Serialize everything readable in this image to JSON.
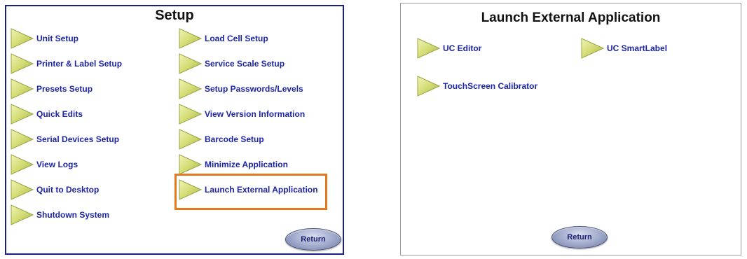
{
  "setup_screen": {
    "title": "Setup",
    "left_items": [
      {
        "label": "Unit Setup"
      },
      {
        "label": "Printer & Label Setup"
      },
      {
        "label": "Presets Setup"
      },
      {
        "label": "Quick Edits"
      },
      {
        "label": "Serial Devices Setup"
      },
      {
        "label": "View Logs"
      },
      {
        "label": "Quit to Desktop"
      },
      {
        "label": "Shutdown System"
      }
    ],
    "right_items": [
      {
        "label": "Load Cell Setup"
      },
      {
        "label": "Service Scale Setup"
      },
      {
        "label": "Setup Passwords/Levels"
      },
      {
        "label": "View Version Information"
      },
      {
        "label": "Barcode Setup"
      },
      {
        "label": "Minimize Application"
      },
      {
        "label": "Launch External Application"
      }
    ],
    "return_label": "Return",
    "highlighted_item": "Launch External Application"
  },
  "launch_screen": {
    "title": "Launch External Application",
    "items": [
      {
        "label": "UC Editor"
      },
      {
        "label": "UC SmartLabel"
      },
      {
        "label": "TouchScreen Calibrator"
      }
    ],
    "return_label": "Return"
  },
  "colors": {
    "setup_border": "#1a1f8c",
    "label_text": "#1c24a8",
    "highlight": "#e07a1d",
    "triangle_fill": "#d6e07a"
  },
  "icons": {
    "menu_arrow": "play-triangle-icon"
  }
}
